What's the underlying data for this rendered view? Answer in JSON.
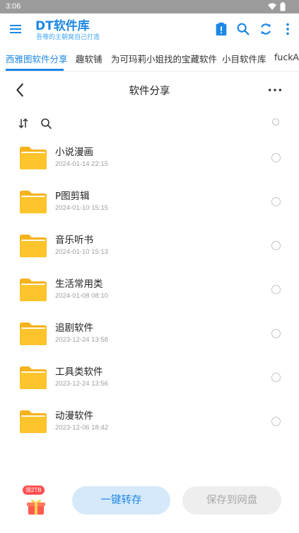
{
  "status": {
    "time": "3:06"
  },
  "appbar": {
    "title": "DT软件库",
    "subtitle": "吾等的主朝窝自己打造",
    "icons": [
      "menu-icon",
      "clipboard-alert-icon",
      "search-icon",
      "refresh-icon",
      "more-vert-icon"
    ]
  },
  "tabs": [
    {
      "label": "西雅图软件分享",
      "active": true
    },
    {
      "label": "趣软铺"
    },
    {
      "label": "为可玛莉小姐找的宝藏软件"
    },
    {
      "label": "小目软件库"
    },
    {
      "label": "fuckAP"
    }
  ],
  "header": {
    "title": "软件分享"
  },
  "files": [
    {
      "name": "小说漫画",
      "date": "2024-01-14 22:15"
    },
    {
      "name": "P图剪辑",
      "date": "2024-01-10 15:15"
    },
    {
      "name": "音乐听书",
      "date": "2024-01-10 15:13"
    },
    {
      "name": "生活常用类",
      "date": "2024-01-08 08:10"
    },
    {
      "name": "追剧软件",
      "date": "2023-12-24 13:58"
    },
    {
      "name": "工具类软件",
      "date": "2023-12-24 13:56"
    },
    {
      "name": "动漫软件",
      "date": "2023-12-06 18:42"
    }
  ],
  "bottom": {
    "badge": "领2TB",
    "save_label": "一键转存",
    "disk_label": "保存到网盘"
  },
  "colors": {
    "accent": "#1e88e5",
    "folder": "#fdc42c"
  }
}
